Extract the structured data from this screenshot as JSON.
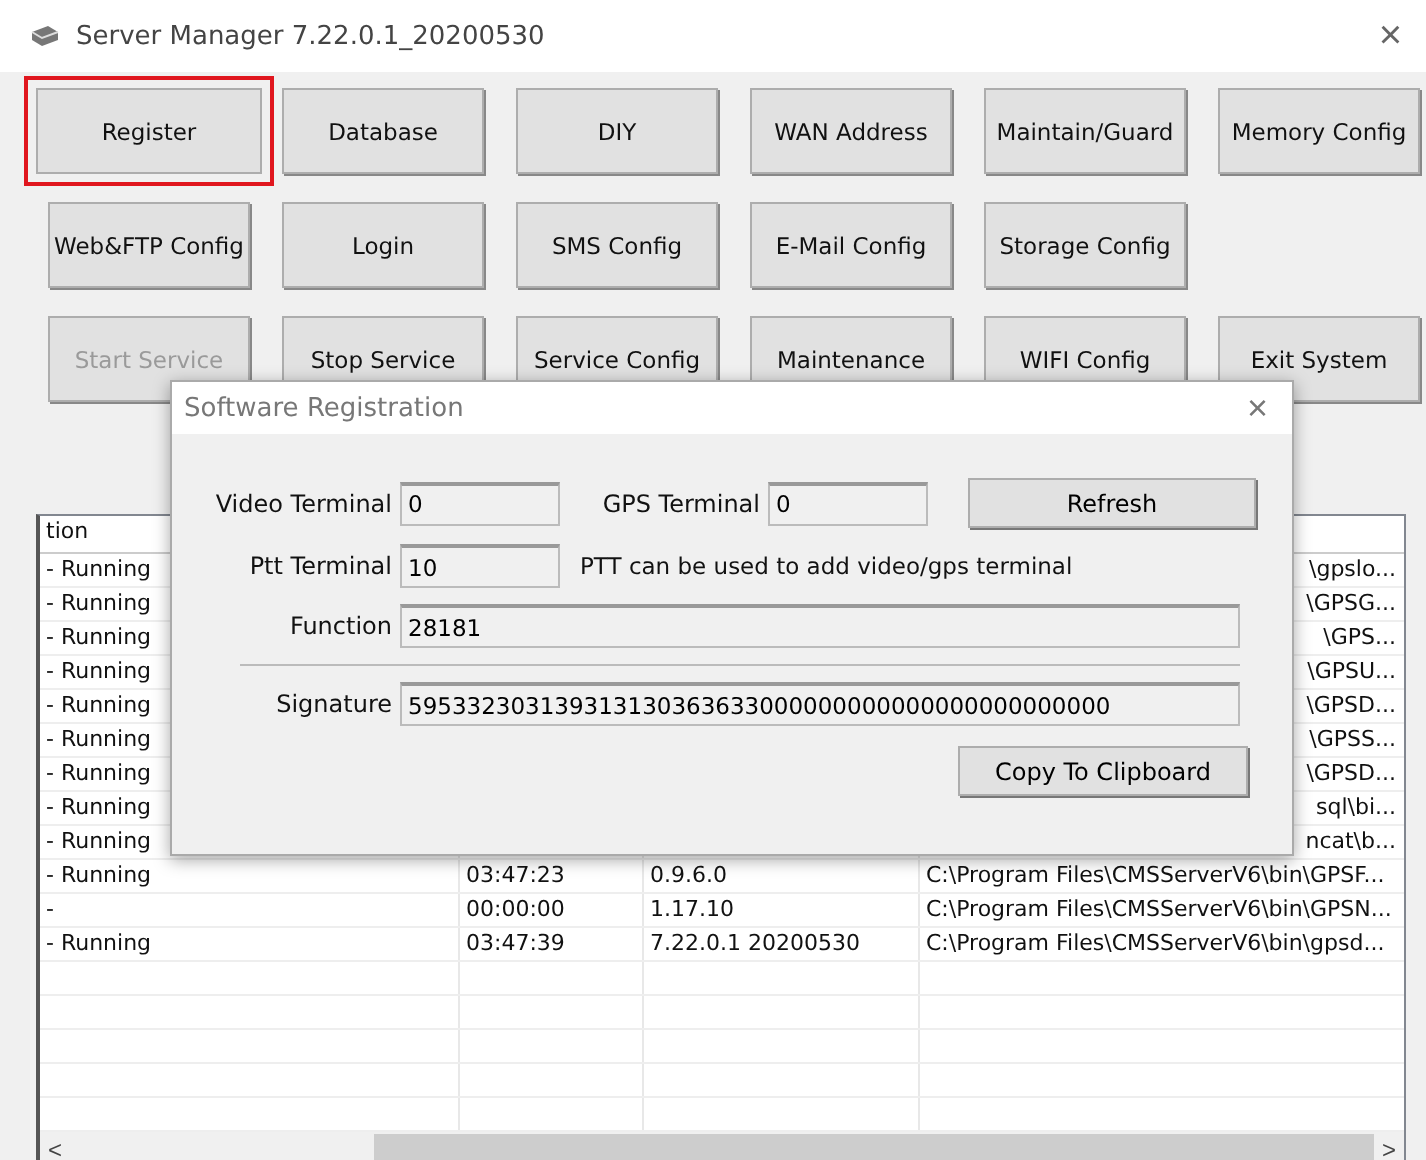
{
  "window": {
    "title": "Server Manager 7.22.0.1_20200530",
    "close": "×"
  },
  "button_rows": [
    [
      {
        "label": "Register",
        "highlighted": true,
        "disabled": false
      },
      {
        "label": "Database",
        "highlighted": false,
        "disabled": false
      },
      {
        "label": "DIY",
        "highlighted": false,
        "disabled": false
      },
      {
        "label": "WAN Address",
        "highlighted": false,
        "disabled": false
      },
      {
        "label": "Maintain/Guard",
        "highlighted": false,
        "disabled": false
      },
      {
        "label": "Memory Config",
        "highlighted": false,
        "disabled": false
      }
    ],
    [
      {
        "label": "Web&FTP Config",
        "highlighted": false,
        "disabled": false
      },
      {
        "label": "Login",
        "highlighted": false,
        "disabled": false
      },
      {
        "label": "SMS Config",
        "highlighted": false,
        "disabled": false
      },
      {
        "label": "E-Mail Config",
        "highlighted": false,
        "disabled": false
      },
      {
        "label": "Storage Config",
        "highlighted": false,
        "disabled": false
      }
    ],
    [
      {
        "label": "Start Service",
        "highlighted": false,
        "disabled": true
      },
      {
        "label": "Stop Service",
        "highlighted": false,
        "disabled": false
      },
      {
        "label": "Service Config",
        "highlighted": false,
        "disabled": false
      },
      {
        "label": "Maintenance",
        "highlighted": false,
        "disabled": false
      },
      {
        "label": "WIFI Config",
        "highlighted": false,
        "disabled": false
      },
      {
        "label": "Exit System",
        "highlighted": false,
        "disabled": false
      }
    ]
  ],
  "table": {
    "columns": [
      "tion"
    ],
    "rows": [
      {
        "column_1": "- Running",
        "column_4": "\\gpslo..."
      },
      {
        "column_1": "- Running",
        "column_4": "\\GPSG..."
      },
      {
        "column_1": "- Running",
        "column_4": "\\GPS..."
      },
      {
        "column_1": "- Running",
        "column_4": "\\GPSU..."
      },
      {
        "column_1": "- Running",
        "column_4": "\\GPSD..."
      },
      {
        "column_1": "- Running",
        "column_4": "\\GPSS..."
      },
      {
        "column_1": "- Running",
        "column_4": "\\GPSD..."
      },
      {
        "column_1": "- Running",
        "column_4": "sql\\bi..."
      },
      {
        "column_1": "- Running",
        "column_4": "ncat\\b..."
      },
      {
        "column_1": "- Running",
        "column_2": "03:47:23",
        "column_3": "0.9.6.0",
        "column_4": "C:\\Program Files\\CMSServerV6\\bin\\GPSF..."
      },
      {
        "column_1": "-",
        "column_2": "00:00:00",
        "column_3": "1.17.10",
        "column_4": "C:\\Program Files\\CMSServerV6\\bin\\GPSN..."
      },
      {
        "column_1": "- Running",
        "column_2": "03:47:39",
        "column_3": "7.22.0.1 20200530",
        "column_4": "C:\\Program Files\\CMSServerV6\\bin\\gpsd..."
      }
    ],
    "scroll_left": "<",
    "scroll_right": ">"
  },
  "dialog": {
    "title": "Software Registration",
    "close": "×",
    "video_terminal": {
      "label": "Video Terminal",
      "value": "0"
    },
    "gps_terminal": {
      "label": "GPS Terminal",
      "value": "0"
    },
    "refresh_button": "Refresh",
    "ptt_terminal": {
      "label": "Ptt Terminal",
      "value": "10"
    },
    "ptt_note": "PTT can be used to add video/gps terminal",
    "function": {
      "label": "Function",
      "value": "28181"
    },
    "signature": {
      "label": "Signature",
      "value": "595332303139313130363633000000000000000000000000"
    },
    "copy_button": "Copy To Clipboard"
  }
}
